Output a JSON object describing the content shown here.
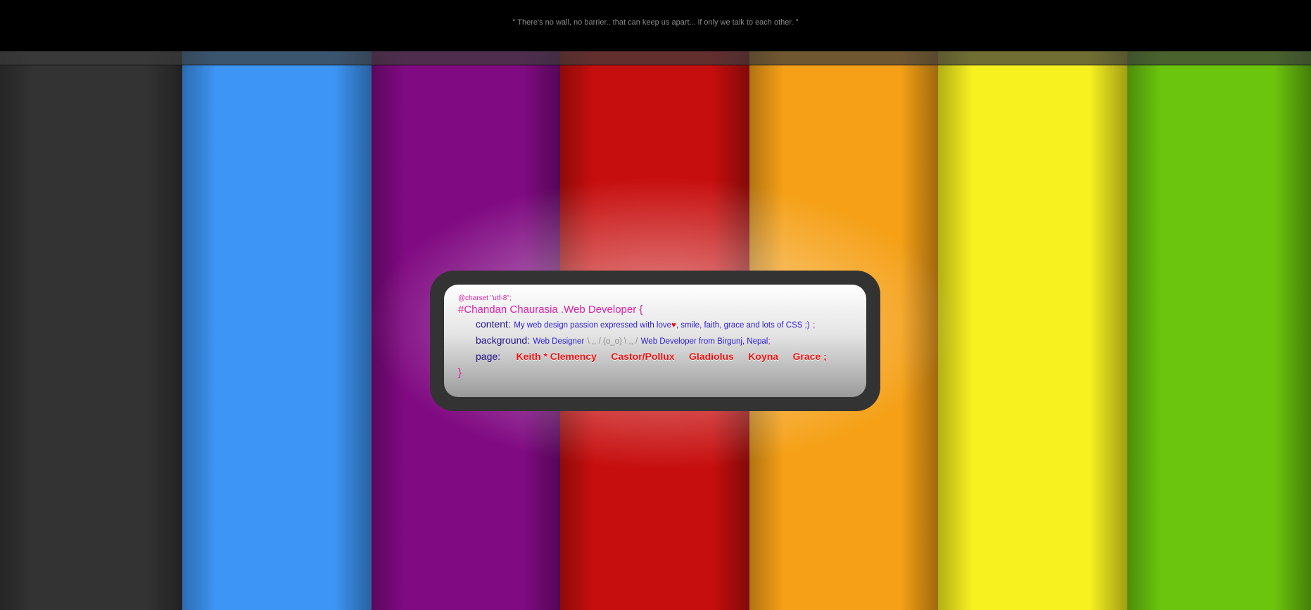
{
  "quote": "\" There's no wall, no barrier.. that can keep us apart... if only we talk to each other. \"",
  "stripes": [
    {
      "color": "#333333"
    },
    {
      "color": "#3d96f5"
    },
    {
      "color": "#800a82"
    },
    {
      "color": "#c70e0e"
    },
    {
      "color": "#f5a016"
    },
    {
      "color": "#f7f11f"
    },
    {
      "color": "#6bc40d"
    }
  ],
  "card": {
    "charset": "@charset \"utf-8\";",
    "selector": "#Chandan Chaurasia .Web Developer {",
    "content_prop": "content:",
    "content_value": "My web design passion expressed with love",
    "heart": "♥",
    "content_value_rest": ", smile, faith, grace and lots of CSS ;)",
    "content_semi": ";",
    "background_prop": "background:",
    "background_part1": "Web Designer",
    "background_face": "\\ ,, / (o_o) \\ ,, /",
    "background_part2": "Web Developer from Birgunj, Nepal",
    "background_semi": ";",
    "page_prop": "page:",
    "pages": [
      "Keith * Clemency",
      "Castor/Pollux",
      "Gladiolus",
      "Koyna",
      "Grace ;"
    ],
    "close": "}"
  }
}
